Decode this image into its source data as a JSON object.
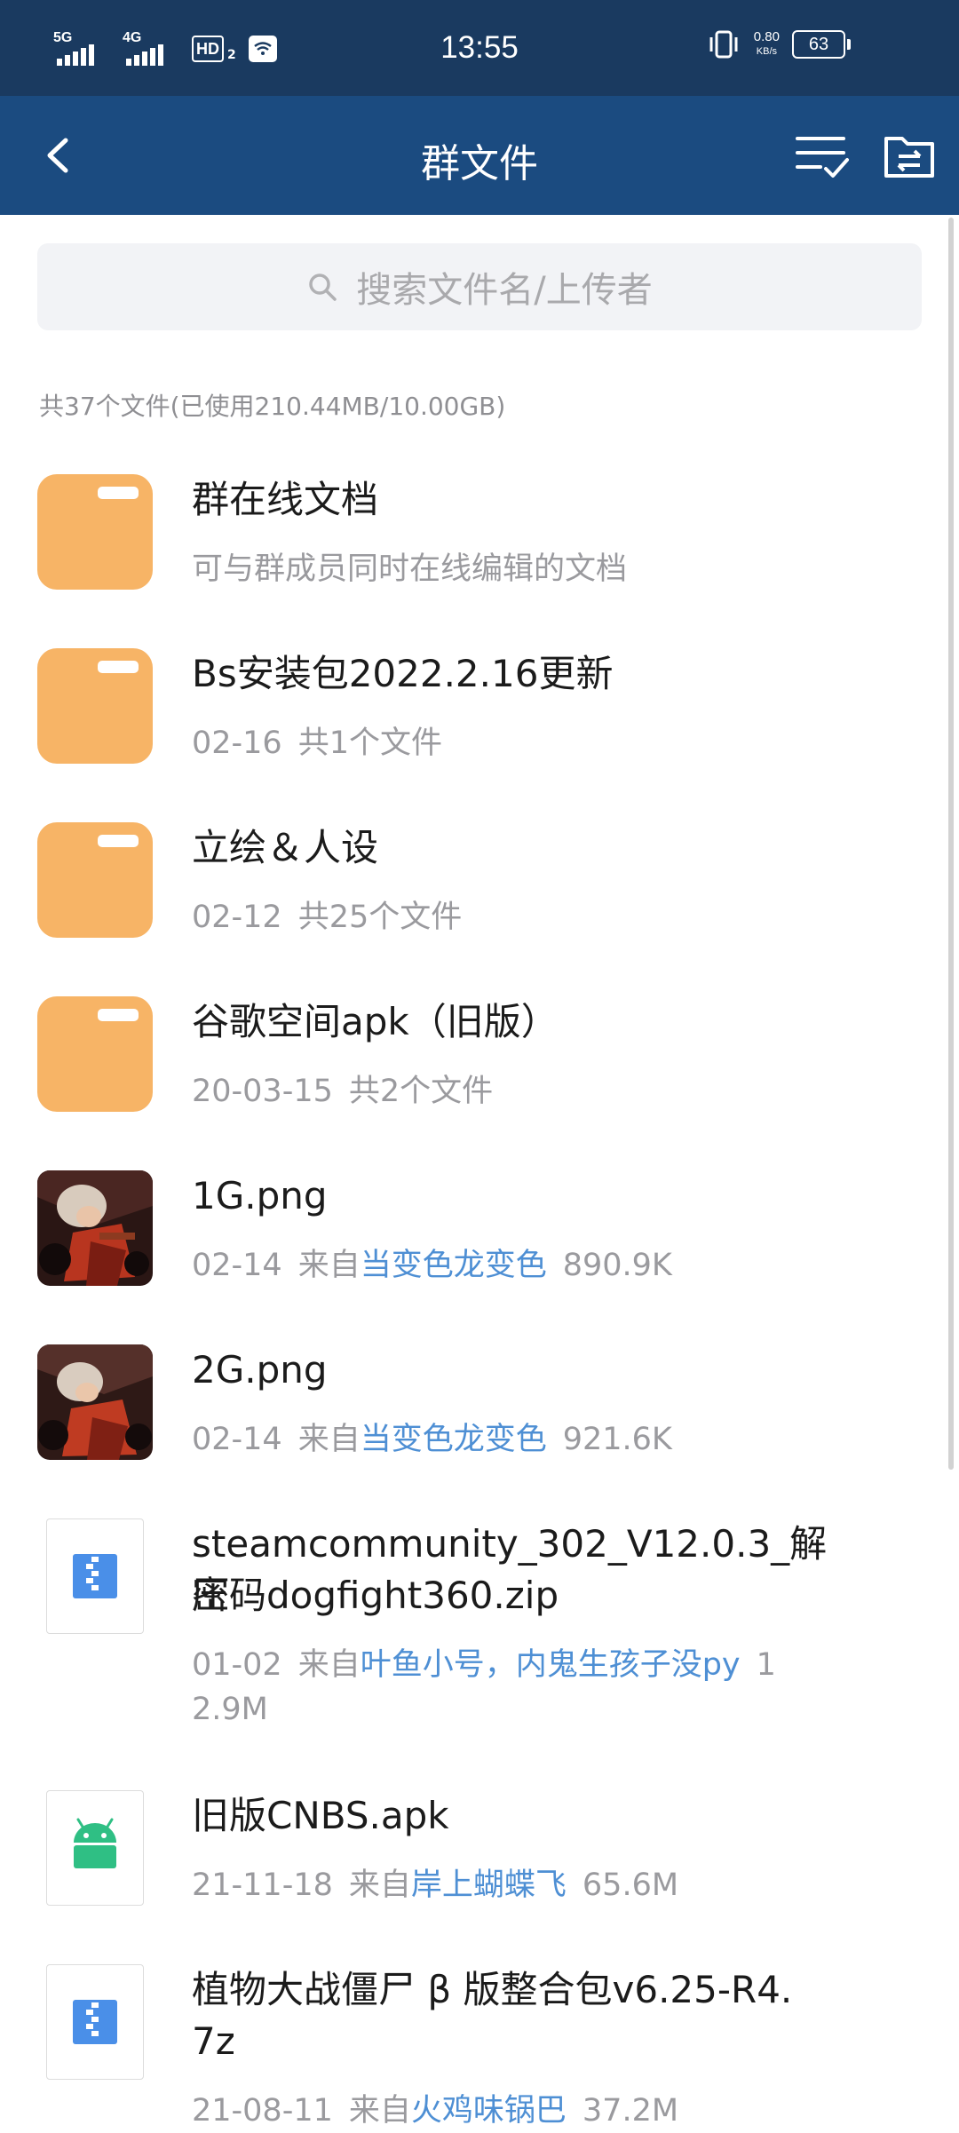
{
  "status_bar": {
    "signal1": "5G",
    "signal2": "4G",
    "hd": "HD",
    "hd_sub": "2",
    "time": "13:55",
    "net_speed": "0.80",
    "net_unit": "KB/s",
    "battery": "63",
    "icons": [
      "signal-icon",
      "hd-icon",
      "wifi-icon",
      "vibrate-icon",
      "battery-icon"
    ]
  },
  "app_bar": {
    "title": "群文件",
    "icons": [
      "back-icon",
      "multi-select-icon",
      "folder-transfer-icon"
    ]
  },
  "search": {
    "placeholder": "搜索文件名/上传者",
    "icon": "search-icon"
  },
  "summary": "共37个文件(已使用210.44MB/10.00GB)",
  "files": [
    {
      "type": "folder",
      "name": "群在线文档",
      "desc": "可与群成员同时在线编辑的文档"
    },
    {
      "type": "folder",
      "name": "Bs安装包2022.2.16更新",
      "date": "02-16",
      "info": "共1个文件"
    },
    {
      "type": "folder",
      "name": "立绘＆人设",
      "date": "02-12",
      "info": "共25个文件"
    },
    {
      "type": "folder",
      "name": "谷歌空间apk（旧版）",
      "date": "20-03-15",
      "info": "共2个文件"
    },
    {
      "type": "image",
      "name": "1G.png",
      "date": "02-14",
      "from": "来自",
      "uploader": "当变色龙变色",
      "size": "890.9K"
    },
    {
      "type": "image",
      "name": "2G.png",
      "date": "02-14",
      "from": "来自",
      "uploader": "当变色龙变色",
      "size": "921.6K"
    },
    {
      "type": "zip",
      "name_line1": "steamcommunity_302_V12.0.3_解压",
      "name_line2": "密码dogfight360.zip",
      "date": "01-02",
      "from": "来自",
      "uploader": "叶鱼小号，内鬼生孩子没py",
      "size_part1": "1",
      "size_part2": "2.9M"
    },
    {
      "type": "apk",
      "name": "旧版CNBS.apk",
      "date": "21-11-18",
      "from": "来自",
      "uploader": "岸上蝴蝶飞",
      "size": "65.6M"
    },
    {
      "type": "zip",
      "name_line1": "植物大战僵尸 β 版整合包v6.25-R4.",
      "name_line2": "7z",
      "date": "21-08-11",
      "from": "来自",
      "uploader": "火鸡味锅巴",
      "size": "37.2M"
    }
  ],
  "colors": {
    "status_bar": "#1a3a60",
    "app_bar": "#1b4b80",
    "folder": "#f7b466",
    "link": "#4e8fd4",
    "zip": "#4a8fe8",
    "apk": "#2fbf84"
  }
}
